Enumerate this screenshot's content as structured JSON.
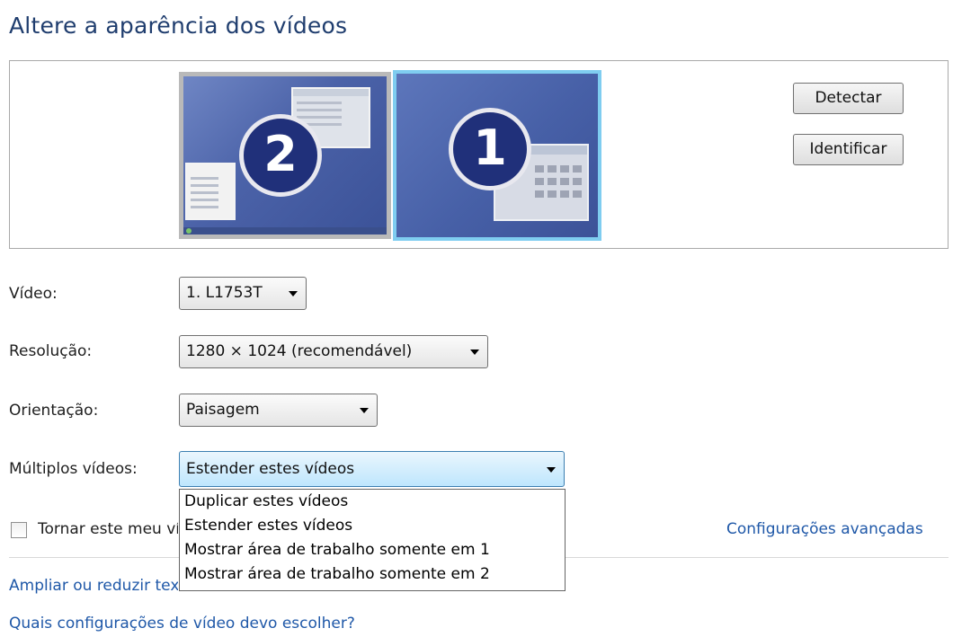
{
  "title": "Altere a aparência dos vídeos",
  "monitors": [
    {
      "number": "2",
      "selected": false
    },
    {
      "number": "1",
      "selected": true
    }
  ],
  "buttons": {
    "detect": "Detectar",
    "identify": "Identificar"
  },
  "fields": {
    "video": {
      "label": "Vídeo:",
      "value": "1. L1753T"
    },
    "resolution": {
      "label": "Resolução:",
      "value": "1280 × 1024 (recomendável)"
    },
    "orientation": {
      "label": "Orientação:",
      "value": "Paisagem"
    },
    "multiple": {
      "label": "Múltiplos vídeos:",
      "value": "Estender estes vídeos"
    }
  },
  "multiple_options": [
    "Duplicar estes vídeos",
    "Estender estes vídeos",
    "Mostrar área de trabalho somente em 1",
    "Mostrar área de trabalho somente em 2"
  ],
  "checkbox": {
    "label": "Tornar este meu vídeo principal",
    "checked": false
  },
  "links": {
    "advanced": "Configurações avançadas",
    "zoom": "Ampliar ou reduzir texto e outros itens",
    "which_settings": "Quais configurações de vídeo devo escolher?"
  },
  "colors": {
    "title": "#1f3d6e",
    "link": "#1f58a8",
    "selected_monitor_border": "#7fcdf0"
  }
}
